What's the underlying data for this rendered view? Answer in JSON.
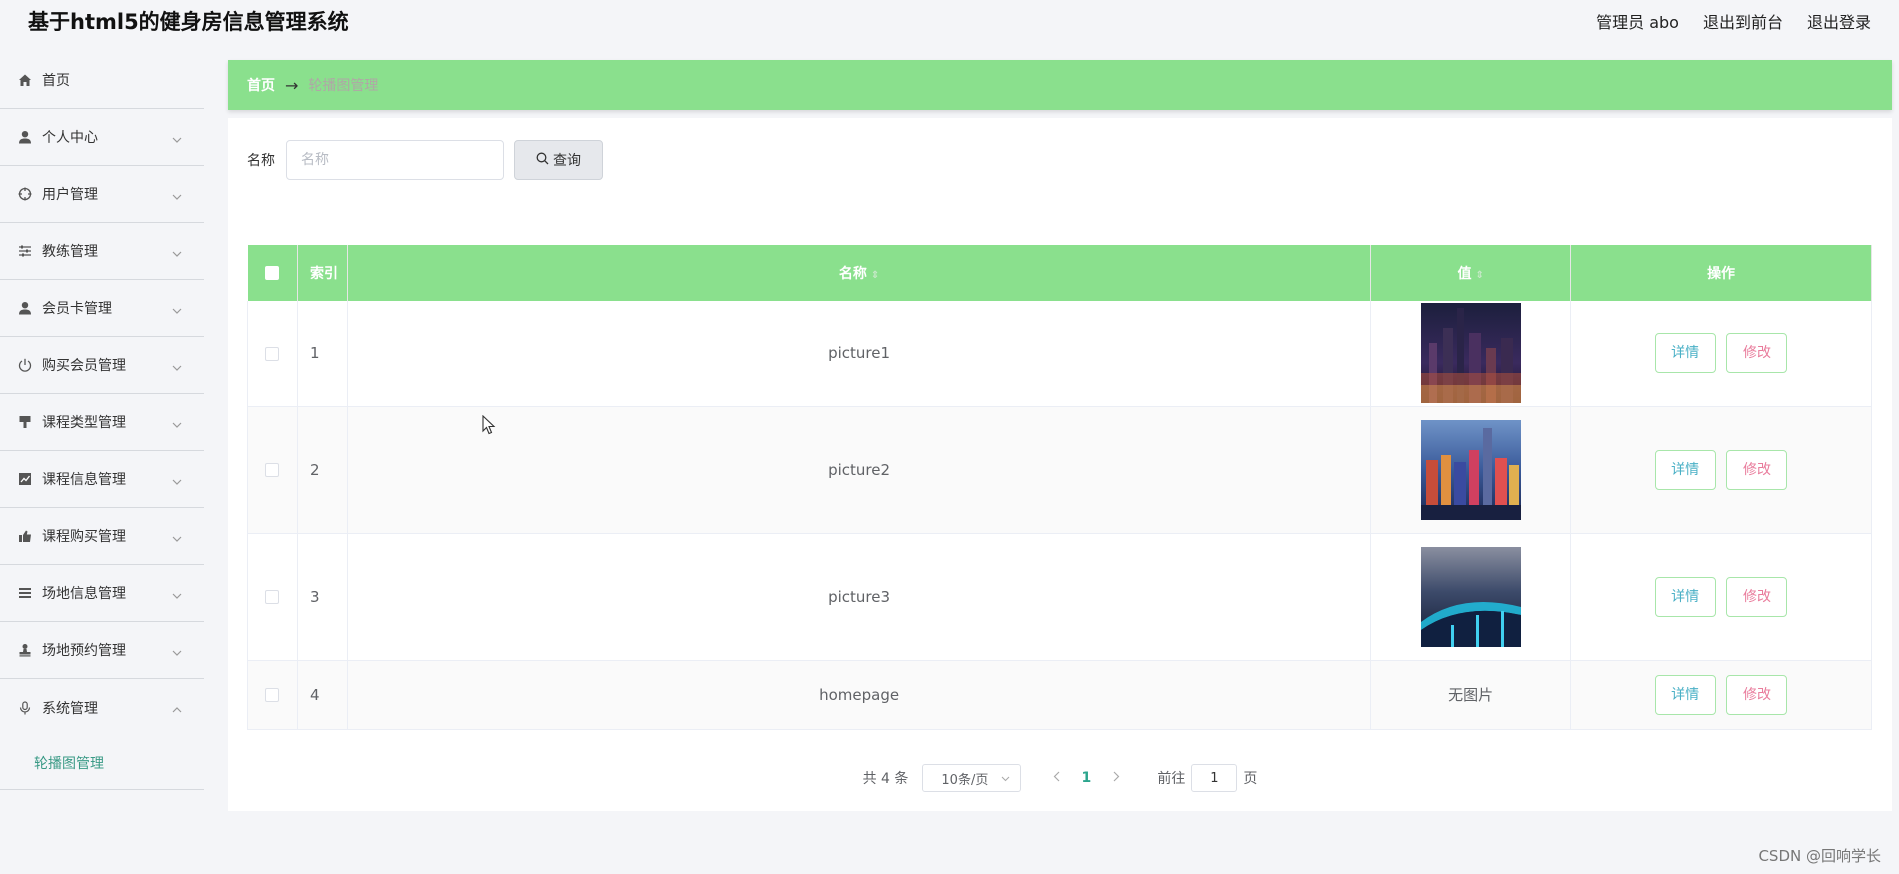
{
  "header": {
    "title": "基于html5的健身房信息管理系统",
    "user_label": "管理员 abo",
    "frontend_link": "退出到前台",
    "logout_link": "退出登录"
  },
  "sidebar": {
    "items": [
      {
        "label": "首页",
        "icon": "home-icon",
        "has_arrow": false
      },
      {
        "label": "个人中心",
        "icon": "user-icon",
        "has_arrow": true
      },
      {
        "label": "用户管理",
        "icon": "target-icon",
        "has_arrow": true
      },
      {
        "label": "教练管理",
        "icon": "sliders-icon",
        "has_arrow": true
      },
      {
        "label": "会员卡管理",
        "icon": "user-icon",
        "has_arrow": true
      },
      {
        "label": "购买会员管理",
        "icon": "power-icon",
        "has_arrow": true
      },
      {
        "label": "课程类型管理",
        "icon": "brush-icon",
        "has_arrow": true
      },
      {
        "label": "课程信息管理",
        "icon": "chart-icon",
        "has_arrow": true
      },
      {
        "label": "课程购买管理",
        "icon": "thumb-icon",
        "has_arrow": true
      },
      {
        "label": "场地信息管理",
        "icon": "list-icon",
        "has_arrow": true
      },
      {
        "label": "场地预约管理",
        "icon": "stamp-icon",
        "has_arrow": true
      },
      {
        "label": "系统管理",
        "icon": "mic-icon",
        "has_arrow": true,
        "expanded": true
      }
    ],
    "submenu_active": "轮播图管理"
  },
  "breadcrumb": {
    "home": "首页",
    "arrow": "→",
    "current": "轮播图管理"
  },
  "search": {
    "label": "名称",
    "placeholder": "名称",
    "value": "",
    "button_label": "查询"
  },
  "table": {
    "columns": {
      "index": "索引",
      "name": "名称",
      "value": "值",
      "actions": "操作"
    },
    "rows": [
      {
        "index": "1",
        "name": "picture1",
        "image": "city-night",
        "value_text": ""
      },
      {
        "index": "2",
        "name": "picture2",
        "image": "city-blur",
        "value_text": ""
      },
      {
        "index": "3",
        "name": "picture3",
        "image": "bridge-night",
        "value_text": ""
      },
      {
        "index": "4",
        "name": "homepage",
        "image": "",
        "value_text": "无图片"
      }
    ],
    "detail_label": "详情",
    "edit_label": "修改"
  },
  "pagination": {
    "total_text": "共 4 条",
    "page_size": "10条/页",
    "current_page": "1",
    "goto_label": "前往",
    "goto_value": "1",
    "page_suffix": "页"
  },
  "watermark": "CSDN @回响学长",
  "colors": {
    "accent": "#8ae08d",
    "active_text": "#2ca58d",
    "detail": "#4ab0c6",
    "edit": "#e97c9c"
  }
}
